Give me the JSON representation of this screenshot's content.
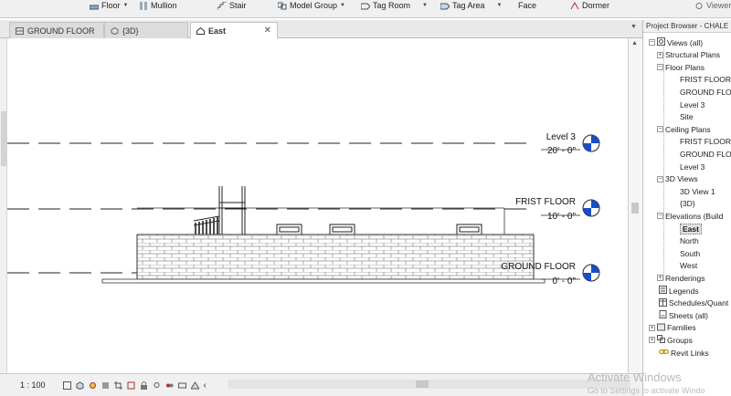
{
  "ribbon": {
    "items": [
      {
        "label": "Floor",
        "icon": "floor-icon",
        "dropdown": true
      },
      {
        "label": "Mullion",
        "icon": "mullion-icon",
        "dropdown": false
      },
      {
        "label": "Stair",
        "icon": "stair-icon",
        "dropdown": false
      },
      {
        "label": "Model Group",
        "icon": "model-group-icon",
        "dropdown": true
      },
      {
        "label": "Tag Room",
        "icon": "tag-room-icon",
        "dropdown": true
      },
      {
        "label": "Tag Area",
        "icon": "tag-area-icon",
        "dropdown": true
      },
      {
        "label": "Face",
        "icon": "face-icon",
        "dropdown": false
      },
      {
        "label": "Dormer",
        "icon": "dormer-icon",
        "dropdown": false
      },
      {
        "label": "Viewer",
        "icon": "viewer-icon",
        "dropdown": false
      }
    ]
  },
  "tabs": [
    {
      "label": "GROUND FLOOR",
      "active": false
    },
    {
      "label": "{3D}",
      "active": false
    },
    {
      "label": "East",
      "active": true
    }
  ],
  "drawing": {
    "levels": [
      {
        "name": "Level 3",
        "elevation": "20' - 0\""
      },
      {
        "name": "FRIST FLOOR",
        "elevation": "10' - 0\""
      },
      {
        "name": "GROUND FLOOR",
        "elevation": "0' - 0\""
      }
    ]
  },
  "status": {
    "scale": "1 : 100"
  },
  "project_browser": {
    "title": "Project Browser - CHALE",
    "nodes": [
      {
        "label": "Views (all)",
        "toggle": "−",
        "icon": "views-icon",
        "level": 0
      },
      {
        "label": "Structural Plans",
        "toggle": "+",
        "level": 1
      },
      {
        "label": "Floor Plans",
        "toggle": "−",
        "level": 1
      },
      {
        "label": "FRIST FLOOR",
        "level": 2
      },
      {
        "label": "GROUND FLOO",
        "level": 2
      },
      {
        "label": "Level 3",
        "level": 2
      },
      {
        "label": "Site",
        "level": 2
      },
      {
        "label": "Ceiling Plans",
        "toggle": "−",
        "level": 1
      },
      {
        "label": "FRIST FLOOR",
        "level": 2
      },
      {
        "label": "GROUND FLO",
        "level": 2
      },
      {
        "label": "Level 3",
        "level": 2
      },
      {
        "label": "3D Views",
        "toggle": "−",
        "level": 1
      },
      {
        "label": "3D View 1",
        "level": 2
      },
      {
        "label": "{3D}",
        "level": 2
      },
      {
        "label": "Elevations (Build",
        "toggle": "−",
        "level": 1
      },
      {
        "label": "East",
        "level": 2,
        "selected": true
      },
      {
        "label": "North",
        "level": 2
      },
      {
        "label": "South",
        "level": 2
      },
      {
        "label": "West",
        "level": 2
      },
      {
        "label": "Renderings",
        "toggle": "+",
        "level": 1
      },
      {
        "label": "Legends",
        "icon": "legends-icon",
        "level": 0
      },
      {
        "label": "Schedules/Quant",
        "icon": "schedules-icon",
        "level": 0
      },
      {
        "label": "Sheets (all)",
        "icon": "sheets-icon",
        "level": 0
      },
      {
        "label": "Families",
        "toggle": "+",
        "icon": "families-icon",
        "level": 0
      },
      {
        "label": "Groups",
        "toggle": "+",
        "icon": "groups-icon",
        "level": 0
      },
      {
        "label": "Revit Links",
        "icon": "revit-links-icon",
        "level": 0
      }
    ]
  },
  "watermark": {
    "line1": "Activate Windows",
    "line2": "Go to Settings to activate Windo"
  },
  "colors": {
    "level_head": "#1a4fc4",
    "accent": "#1a4fc4"
  }
}
